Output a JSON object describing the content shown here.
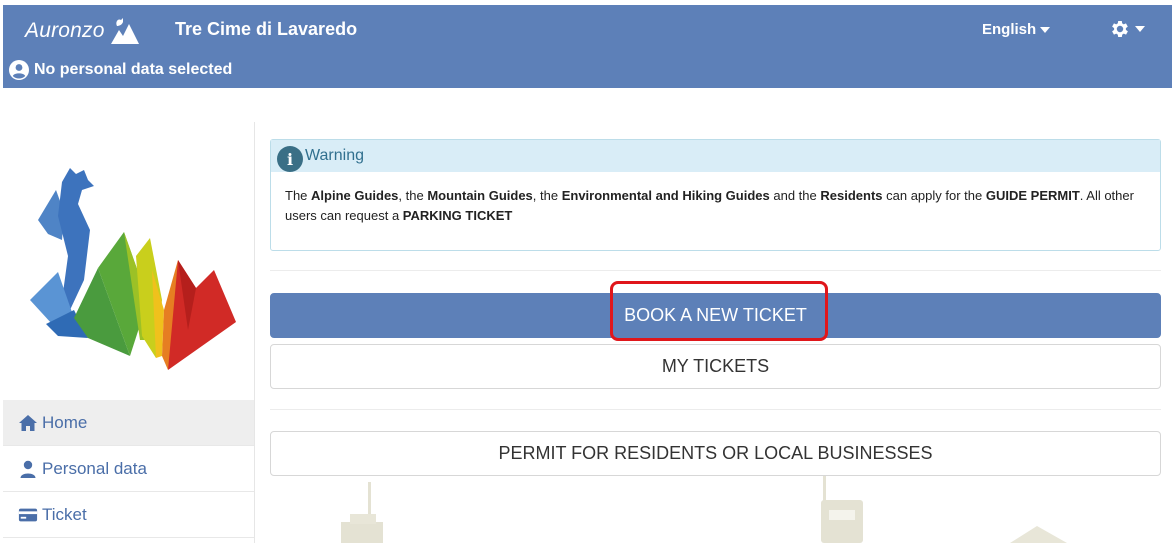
{
  "header": {
    "brand": "Auronzo",
    "title": "Tre Cime di Lavaredo",
    "language": "English",
    "user_status": "No personal data selected"
  },
  "sidebar": {
    "items": [
      {
        "label": "Home",
        "icon": "home-icon",
        "active": true
      },
      {
        "label": "Personal data",
        "icon": "user-icon",
        "active": false
      },
      {
        "label": "Ticket",
        "icon": "credit-card-icon",
        "active": false
      }
    ]
  },
  "warning": {
    "title": "Warning",
    "parts": [
      {
        "text": "The ",
        "bold": false
      },
      {
        "text": "Alpine Guides",
        "bold": true
      },
      {
        "text": ", the ",
        "bold": false
      },
      {
        "text": "Mountain Guides",
        "bold": true
      },
      {
        "text": ", the ",
        "bold": false
      },
      {
        "text": "Environmental and Hiking Guides",
        "bold": true
      },
      {
        "text": " and the ",
        "bold": false
      },
      {
        "text": "Residents",
        "bold": true
      },
      {
        "text": " can apply for the ",
        "bold": false
      },
      {
        "text": "GUIDE PERMIT",
        "bold": true
      },
      {
        "text": ". All other users can request a ",
        "bold": false
      },
      {
        "text": "PARKING TICKET",
        "bold": true
      }
    ]
  },
  "actions": {
    "book_new_ticket": "BOOK A NEW TICKET",
    "my_tickets": "MY TICKETS",
    "permit_residents": "PERMIT FOR RESIDENTS OR LOCAL BUSINESSES"
  },
  "colors": {
    "header_bg": "#5d80b8",
    "primary_button": "#5d80b8",
    "highlight_box": "#e0161b",
    "warning_bg": "#d9edf7",
    "nav_text": "#4a6ea8"
  }
}
